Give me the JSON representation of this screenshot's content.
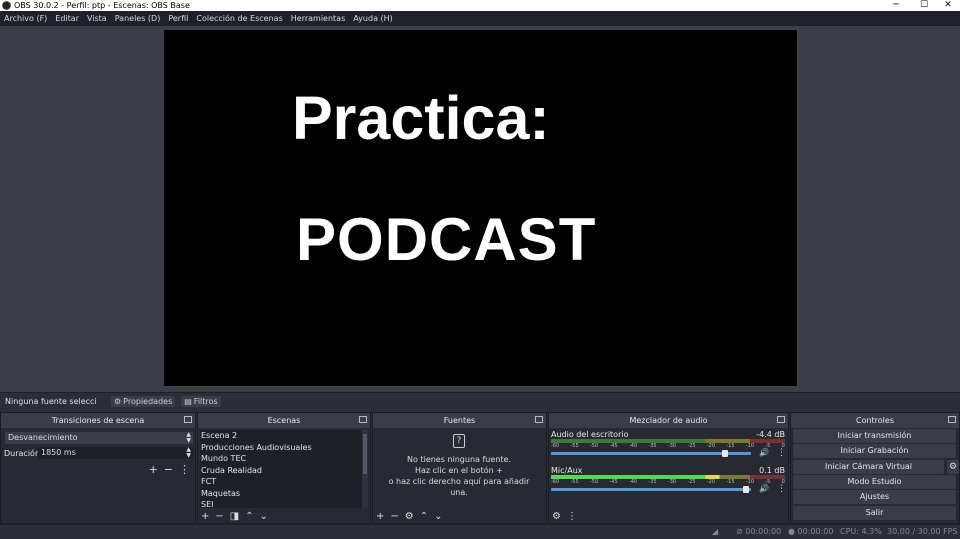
{
  "window": {
    "title": "OBS 30.0.2 - Perfil: ptp - Escenas: OBS Base",
    "minimize": "─",
    "maximize": "☐",
    "close": "✕"
  },
  "menu": [
    "Archivo (F)",
    "Editar",
    "Vista",
    "Paneles (D)",
    "Perfil",
    "Colección de Escenas",
    "Herramientas",
    "Ayuda (H)"
  ],
  "preview": {
    "line1": "Practica:",
    "line2": "PODCAST"
  },
  "context_bar": {
    "no_source": "Ninguna fuente selecci",
    "properties": "Propiedades",
    "filters": "Filtros"
  },
  "transitions": {
    "title": "Transiciones de escena",
    "selected": "Desvanecimiento",
    "duration_label": "Duración",
    "duration_value": "1850 ms"
  },
  "scenes": {
    "title": "Escenas",
    "items": [
      "Escena 2",
      "Producciones Audiovisuales",
      "Mundo TEC",
      "Cruda Realidad",
      "FCT",
      "Maquetas",
      "SEI"
    ]
  },
  "sources": {
    "title": "Fuentes",
    "empty_line1": "No tienes ninguna fuente.",
    "empty_line2": "Haz clic en el botón",
    "empty_line3": "o haz clic derecho aquí para añadir",
    "empty_line4": "una."
  },
  "mixer": {
    "title": "Mezclador de audio",
    "tracks": [
      {
        "name": "Audio del escritorio",
        "db": "-4.4 dB",
        "volume": 0.88
      },
      {
        "name": "Mic/Aux",
        "db": "0.1 dB",
        "volume": 0.99
      }
    ],
    "scale": [
      "-60",
      "-55",
      "-50",
      "-45",
      "-40",
      "-35",
      "-30",
      "-25",
      "-20",
      "-15",
      "-10",
      "-5",
      "0"
    ]
  },
  "controls": {
    "title": "Controles",
    "buttons": [
      "Iniciar transmisión",
      "Iniciar Grabación",
      "Iniciar Cámara Virtual",
      "Modo Estudio",
      "Ajustes",
      "Salir"
    ]
  },
  "status": {
    "stream_time": "00:00:00",
    "rec_time": "00:00:00",
    "cpu": "CPU: 4.3%",
    "fps": "30.00 / 30.00 FPS"
  }
}
